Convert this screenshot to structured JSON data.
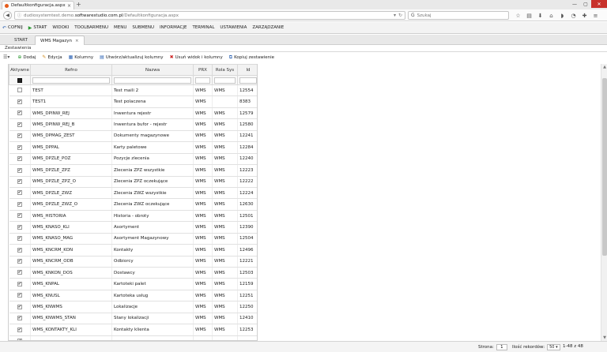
{
  "browser": {
    "tab_title": "Defaultkonfiguracja.aspx",
    "new_tab": "+",
    "url_prefix": "dudiosystemtest.demo.",
    "url_domain": "softwarestudio.com.pl",
    "url_suffix": "/Defaultkonfiguracja.aspx",
    "search_placeholder": "Szukaj"
  },
  "menu": {
    "items": [
      "COFNIJ",
      "START",
      "WIDOKI",
      "TOOLBARMENU",
      "MENU",
      "SUBMENU",
      "INFORMACJE",
      "TERMINAL",
      "USTAWIENIA",
      "ZARZĄDZANIE"
    ]
  },
  "tabs": {
    "start": "START",
    "active": "WMS Magazyn",
    "close": "×"
  },
  "section_label": "Zestawienia",
  "toolbar": {
    "add": "Dodaj",
    "edit": "Edycja",
    "columns": "Kolumny",
    "create_update": "Utwórz/aktualizuj kolumny",
    "delete_view": "Usuń widok i kolumny",
    "copy": "Kopiuj zestawienie"
  },
  "grid": {
    "headers": [
      "Aktywne",
      "Refno",
      "Nazwa",
      "PRX",
      "Rola Sys",
      "Id"
    ],
    "rows": [
      {
        "active": false,
        "refno": "TEST",
        "name": "Test maili 2",
        "prx": "WMS",
        "rola": "WMS",
        "id": "12554"
      },
      {
        "active": true,
        "refno": "TEST1",
        "name": "Test polaczena",
        "prx": "WMS",
        "rola": "",
        "id": "8383"
      },
      {
        "active": true,
        "refno": "WMS_DPINW_REJ",
        "name": "Inwentura rejestr",
        "prx": "WMS",
        "rola": "WMS",
        "id": "12579"
      },
      {
        "active": true,
        "refno": "WMS_DPINW_REJ_B",
        "name": "Inwentura bufor - rejestr",
        "prx": "WMS",
        "rola": "WMS",
        "id": "12580"
      },
      {
        "active": true,
        "refno": "WMS_DPMAG_ZEST",
        "name": "Dokumenty magazynowe",
        "prx": "WMS",
        "rola": "WMS",
        "id": "12241"
      },
      {
        "active": true,
        "refno": "WMS_DPPAL",
        "name": "Karty paletowe",
        "prx": "WMS",
        "rola": "WMS",
        "id": "12284"
      },
      {
        "active": true,
        "refno": "WMS_DPZLE_POZ",
        "name": "Pozycje zlecenia",
        "prx": "WMS",
        "rola": "WMS",
        "id": "12240"
      },
      {
        "active": true,
        "refno": "WMS_DPZLE_ZPZ",
        "name": "Zlecenia ZPZ wszystkie",
        "prx": "WMS",
        "rola": "WMS",
        "id": "12223"
      },
      {
        "active": true,
        "refno": "WMS_DPZLE_ZPZ_O",
        "name": "Zlecenia ZPZ oczekujące",
        "prx": "WMS",
        "rola": "WMS",
        "id": "12222"
      },
      {
        "active": true,
        "refno": "WMS_DPZLE_ZWZ",
        "name": "Zlecenia ZWZ wszystkie",
        "prx": "WMS",
        "rola": "WMS",
        "id": "12224"
      },
      {
        "active": true,
        "refno": "WMS_DPZLE_ZWZ_O",
        "name": "Zlecenia ZWZ oczekujące",
        "prx": "WMS",
        "rola": "WMS",
        "id": "12630"
      },
      {
        "active": true,
        "refno": "WMS_HISTORIA",
        "name": "Historia - obroty",
        "prx": "WMS",
        "rola": "WMS",
        "id": "12501"
      },
      {
        "active": true,
        "refno": "WMS_KNASO_KLI",
        "name": "Asortyment",
        "prx": "WMS",
        "rola": "WMS",
        "id": "12390"
      },
      {
        "active": true,
        "refno": "WMS_KNASO_MAG",
        "name": "Asortyment Magazynowy",
        "prx": "WMS",
        "rola": "WMS",
        "id": "12504"
      },
      {
        "active": true,
        "refno": "WMS_KNCRM_KON",
        "name": "Kontakty",
        "prx": "WMS",
        "rola": "WMS",
        "id": "12496"
      },
      {
        "active": true,
        "refno": "WMS_KNCRM_ODB",
        "name": "Odbiorcy",
        "prx": "WMS",
        "rola": "WMS",
        "id": "12221"
      },
      {
        "active": true,
        "refno": "WMS_KNKON_DOS",
        "name": "Dostawcy",
        "prx": "WMS",
        "rola": "WMS",
        "id": "12503"
      },
      {
        "active": true,
        "refno": "WMS_KNPAL",
        "name": "Kartoteki palet",
        "prx": "WMS",
        "rola": "WMS",
        "id": "12159"
      },
      {
        "active": true,
        "refno": "WMS_KNUSL",
        "name": "Kartoteka usług",
        "prx": "WMS",
        "rola": "WMS",
        "id": "12251"
      },
      {
        "active": true,
        "refno": "WMS_KNWMS",
        "name": "Lokalizacje",
        "prx": "WMS",
        "rola": "WMS",
        "id": "12250"
      },
      {
        "active": true,
        "refno": "WMS_KNWMS_STAN",
        "name": "Stany lokalizacji",
        "prx": "WMS",
        "rola": "WMS",
        "id": "12410"
      },
      {
        "active": true,
        "refno": "WMS_KONTAKTY_KLI",
        "name": "Kontakty klienta",
        "prx": "WMS",
        "rola": "WMS",
        "id": "12253"
      },
      {
        "active": true,
        "refno": "",
        "name": "",
        "prx": "",
        "rola": "",
        "id": ""
      }
    ]
  },
  "pager": {
    "page_label": "Strona:",
    "page_value": "1",
    "count_label": "Ilość rekordów:",
    "count_value": "50",
    "range": "1-48 z 48"
  },
  "colors": {
    "accent_green": "#2b9a31",
    "accent_blue": "#2d63b4",
    "danger_red": "#cc2222",
    "browser_close": "#c7312b"
  }
}
